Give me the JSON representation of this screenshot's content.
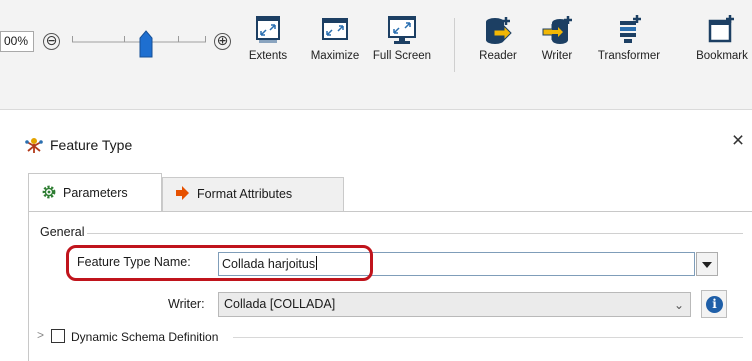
{
  "toolbar": {
    "zoom_value": "00%",
    "zoom_out_symbol": "⊖",
    "zoom_in_symbol": "⊕",
    "buttons": [
      {
        "label": "Extents",
        "icon": "extents-icon"
      },
      {
        "label": "Maximize",
        "icon": "maximize-icon"
      },
      {
        "label": "Full Screen",
        "icon": "full-screen-icon"
      },
      {
        "label": "Reader",
        "icon": "reader-icon"
      },
      {
        "label": "Writer",
        "icon": "writer-icon"
      },
      {
        "label": "Transformer",
        "icon": "transformer-icon"
      },
      {
        "label": "Bookmark",
        "icon": "bookmark-icon"
      }
    ]
  },
  "dialog": {
    "title": "Feature Type",
    "close_symbol": "×",
    "tabs": [
      {
        "label": "Parameters",
        "icon": "gear-icon",
        "active": true
      },
      {
        "label": "Format Attributes",
        "icon": "arrow-right-icon",
        "active": false
      }
    ],
    "general": {
      "group_label": "General",
      "feature_type_name_label": "Feature Type Name:",
      "feature_type_name_value": "Collada harjoitus",
      "writer_label": "Writer:",
      "writer_value": "Collada [COLLADA]",
      "writer_chevron": "⌄",
      "info_symbol": "i"
    },
    "dynamic_schema": {
      "expander_symbol": ">",
      "label": "Dynamic Schema Definition",
      "checked": false
    }
  },
  "colors": {
    "highlight": "#c0141c",
    "toolbar_bg": "#f3f3f3",
    "info_blue": "#1f5fa8"
  }
}
